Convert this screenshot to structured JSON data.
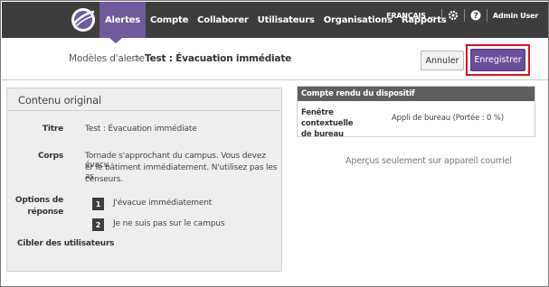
{
  "nav": {
    "items": [
      {
        "label": "Alertes",
        "active": true
      },
      {
        "label": "Compte",
        "active": false
      },
      {
        "label": "Collaborer",
        "active": false
      },
      {
        "label": "Utilisateurs",
        "active": false
      },
      {
        "label": "Organisations",
        "active": false
      },
      {
        "label": "Rapports",
        "active": false
      }
    ],
    "language": "FRANÇAIS ...",
    "user": "Admin User",
    "icons": [
      "gear-icon",
      "help-icon"
    ]
  },
  "breadcrumb": {
    "parent": "Modèles d'alerte",
    "separator": ">",
    "current": "Test : Évacuation immédiate"
  },
  "actions": {
    "cancel_label": "Annuler",
    "save_label": "Enregistrer"
  },
  "original_content": {
    "heading": "Contenu original",
    "title_label": "Titre",
    "title_value": "Test : Évacuation immédiate",
    "body_label": "Corps",
    "body_lines": [
      "Tornade s'approchant du campus. Vous devez évacu",
      "er le bâtiment immédiatement. N'utilisez pas les as",
      "censeurs."
    ],
    "options_label_lines": [
      "Options de",
      "réponse"
    ],
    "options": [
      {
        "number": "1",
        "text": "J'évacue immédiatement"
      },
      {
        "number": "2",
        "text": "Je ne suis pas sur le campus"
      }
    ],
    "target_users_label": "Cibler des utilisateurs"
  },
  "device_render": {
    "header": "Compte rendu du dispositif",
    "label_lines": [
      "Fenêtre contextuelle",
      "de bureau"
    ],
    "value": "Appli de bureau (Portée : 0 %)",
    "preview_note": "Aperçus seulement sur appareil courriel"
  },
  "colors": {
    "nav_bg": "#3d3d3d",
    "nav_active": "#6e5a9c",
    "save_button": "#6b4f9a",
    "highlight_border": "#e0121a",
    "panel_bg": "#eeeeee",
    "table_header": "#5f5f5f"
  }
}
